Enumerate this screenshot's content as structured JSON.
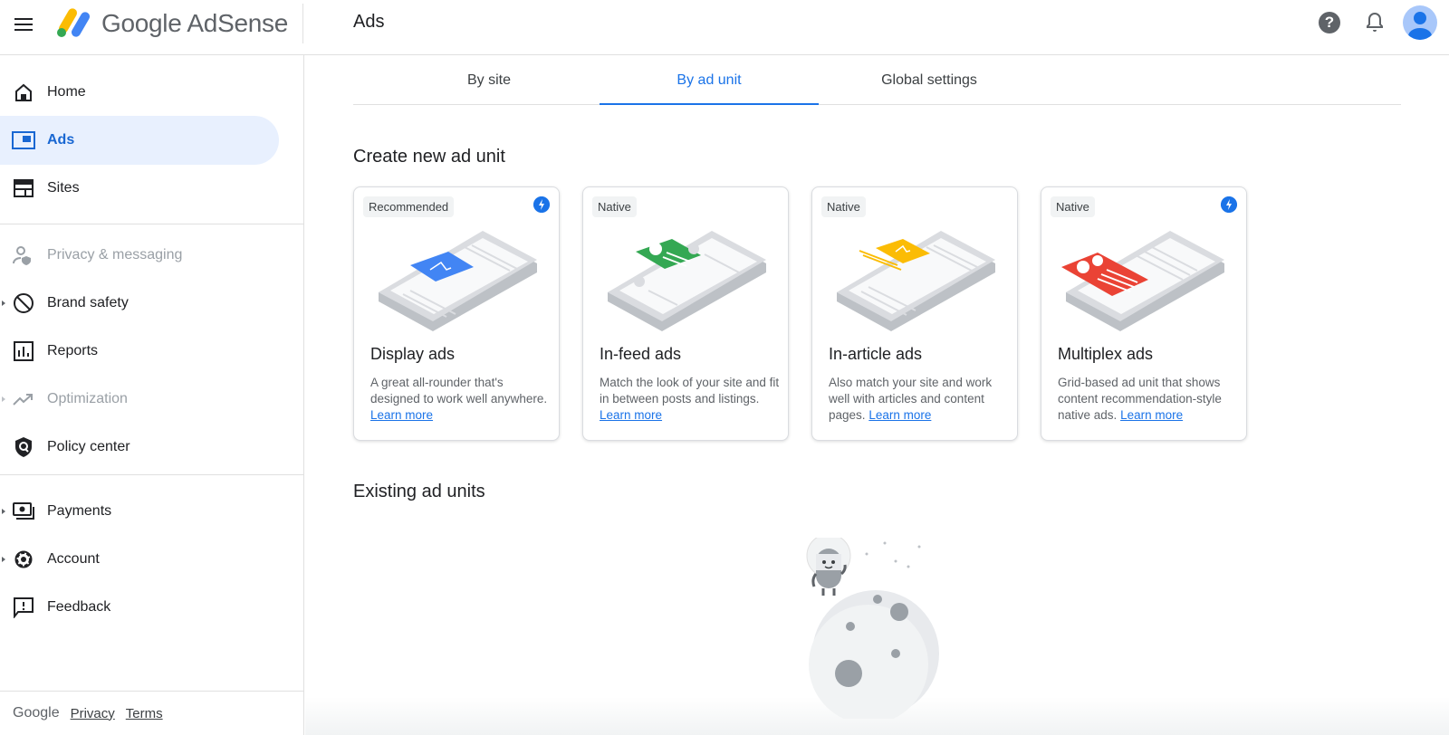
{
  "header": {
    "menu_icon": "menu-icon",
    "brand": "Google AdSense",
    "page_title": "Ads",
    "help_icon": "help-icon",
    "help_glyph": "?",
    "notifications_icon": "bell-icon",
    "avatar_icon": "account-avatar"
  },
  "sidebar": {
    "items": [
      {
        "label": "Home",
        "icon": "home-icon"
      },
      {
        "label": "Ads",
        "icon": "ads-icon",
        "active": true
      },
      {
        "label": "Sites",
        "icon": "sites-icon"
      },
      {
        "label": "Privacy & messaging",
        "icon": "privacy-icon",
        "disabled": true
      },
      {
        "label": "Brand safety",
        "icon": "block-icon",
        "expandable": true
      },
      {
        "label": "Reports",
        "icon": "reports-icon"
      },
      {
        "label": "Optimization",
        "icon": "trending-icon",
        "expandable": true,
        "disabled": true
      },
      {
        "label": "Policy center",
        "icon": "policy-shield-icon"
      },
      {
        "label": "Payments",
        "icon": "payments-icon",
        "expandable": true
      },
      {
        "label": "Account",
        "icon": "gear-icon",
        "expandable": true
      },
      {
        "label": "Feedback",
        "icon": "feedback-icon"
      }
    ],
    "footer": {
      "google": "Google",
      "privacy": "Privacy",
      "terms": "Terms"
    }
  },
  "tabs": [
    {
      "label": "By site"
    },
    {
      "label": "By ad unit",
      "active": true
    },
    {
      "label": "Global settings"
    }
  ],
  "create_section": {
    "title": "Create new ad unit",
    "learn_more": "Learn more",
    "cards": [
      {
        "chip": "Recommended",
        "amp_icon": true,
        "title": "Display ads",
        "desc": "A great all-rounder that's designed to work well anywhere.",
        "accent": "#4285f4"
      },
      {
        "chip": "Native",
        "amp_icon": false,
        "title": "In-feed ads",
        "desc": "Match the look of your site and fit in between posts and listings.",
        "accent": "#34a853"
      },
      {
        "chip": "Native",
        "amp_icon": false,
        "title": "In-article ads",
        "desc": "Also match your site and work well with articles and content pages.",
        "accent": "#fbbc04"
      },
      {
        "chip": "Native",
        "amp_icon": true,
        "title": "Multiplex ads",
        "desc": "Grid-based ad unit that shows content recommendation-style native ads.",
        "accent": "#ea4335"
      }
    ]
  },
  "existing_section": {
    "title": "Existing ad units",
    "empty_illustration": "astronaut-on-moon-illustration"
  },
  "colors": {
    "primary": "#1a73e8",
    "active_bg": "#e8f0fe"
  }
}
